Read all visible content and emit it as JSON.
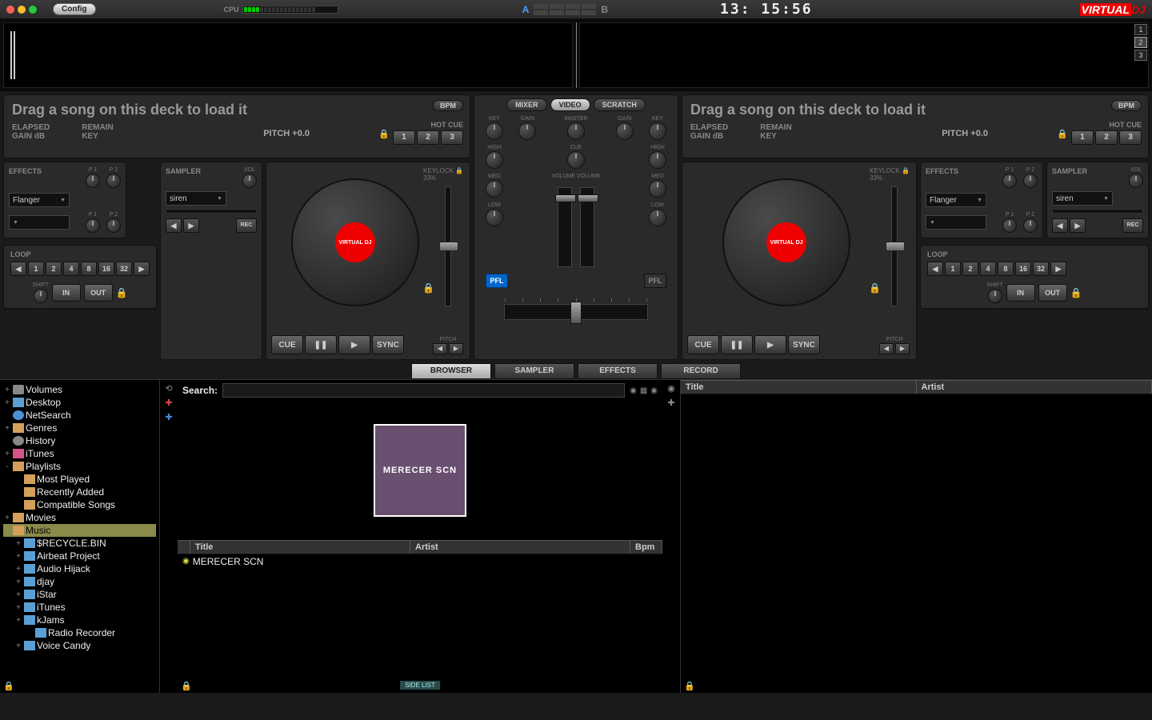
{
  "topbar": {
    "config": "Config",
    "cpu": "CPU",
    "clock": "13: 15:56",
    "logo_v": "VIRTUAL",
    "logo_d": "DJ",
    "deck_a": "A",
    "deck_b": "B"
  },
  "pages": [
    "1",
    "2",
    "3"
  ],
  "deck": {
    "drag": "Drag a song on this deck to load it",
    "elapsed": "ELAPSED",
    "remain": "REMAIN",
    "gain": "GAIN dB",
    "key_lbl": "KEY",
    "pitch": "PITCH +0.0",
    "bpm": "BPM",
    "hotcue": "HOT CUE",
    "cues": [
      "1",
      "2",
      "3"
    ],
    "effects": "EFFECTS",
    "sampler": "SAMPLER",
    "loop": "LOOP",
    "fx_sel": "Flanger",
    "smp_sel": "siren",
    "knobs": {
      "p1": "P 1",
      "p2": "P 2",
      "vol": "VOL",
      "rec": "REC"
    },
    "loops": [
      "1",
      "2",
      "4",
      "8",
      "16",
      "32"
    ],
    "shift": "SHIFT",
    "in": "IN",
    "out": "OUT",
    "keylock": "KEYLOCK",
    "keylock_pct": "33%",
    "pitch_lbl": "PITCH",
    "cue": "CUE",
    "sync": "SYNC",
    "jog": "VIRTUAL DJ"
  },
  "mixer": {
    "tabs": {
      "mixer": "MIXER",
      "video": "VIDEO",
      "scratch": "SCRATCH"
    },
    "knobs": {
      "key": "KEY",
      "gain": "GAIN",
      "master": "MASTER",
      "cue": "CUE",
      "high": "HIGH",
      "med": "MED",
      "low": "LOW",
      "volume": "VOLUME"
    },
    "pfl": "PFL"
  },
  "browser_tabs": {
    "browser": "BROWSER",
    "sampler": "SAMPLER",
    "effects": "EFFECTS",
    "record": "RECORD"
  },
  "tree": [
    {
      "exp": "+",
      "ico": "ico-disk",
      "txt": "Volumes",
      "lvl": 0
    },
    {
      "exp": "+",
      "ico": "ico-folder",
      "txt": "Desktop",
      "lvl": 0
    },
    {
      "exp": "",
      "ico": "ico-globe",
      "txt": "NetSearch",
      "lvl": 0
    },
    {
      "exp": "+",
      "ico": "ico-folder-y",
      "txt": "Genres",
      "lvl": 0
    },
    {
      "exp": "",
      "ico": "ico-clock",
      "txt": "History",
      "lvl": 0
    },
    {
      "exp": "+",
      "ico": "ico-note",
      "txt": "iTunes",
      "lvl": 0
    },
    {
      "exp": "-",
      "ico": "ico-folder-y",
      "txt": "Playlists",
      "lvl": 0
    },
    {
      "exp": "",
      "ico": "ico-folder-y",
      "txt": "Most Played",
      "lvl": 1
    },
    {
      "exp": "",
      "ico": "ico-folder-y",
      "txt": "Recently Added",
      "lvl": 1
    },
    {
      "exp": "",
      "ico": "ico-folder-y",
      "txt": "Compatible Songs",
      "lvl": 1
    },
    {
      "exp": "+",
      "ico": "ico-folder-y",
      "txt": "Movies",
      "lvl": 0
    },
    {
      "exp": "-",
      "ico": "ico-folder-y",
      "txt": "Music",
      "lvl": 0,
      "sel": true
    },
    {
      "exp": "+",
      "ico": "ico-folder",
      "txt": "$RECYCLE.BIN",
      "lvl": 1
    },
    {
      "exp": "+",
      "ico": "ico-folder",
      "txt": "Airbeat Project",
      "lvl": 1
    },
    {
      "exp": "+",
      "ico": "ico-folder",
      "txt": "Audio Hijack",
      "lvl": 1
    },
    {
      "exp": "+",
      "ico": "ico-folder",
      "txt": "djay",
      "lvl": 1
    },
    {
      "exp": "+",
      "ico": "ico-folder",
      "txt": "iStar",
      "lvl": 1
    },
    {
      "exp": "+",
      "ico": "ico-folder",
      "txt": "iTunes",
      "lvl": 1
    },
    {
      "exp": "+",
      "ico": "ico-folder",
      "txt": "kJams",
      "lvl": 1
    },
    {
      "exp": "",
      "ico": "ico-folder",
      "txt": "Radio Recorder",
      "lvl": 2
    },
    {
      "exp": "+",
      "ico": "ico-folder",
      "txt": "Voice Candy",
      "lvl": 1
    }
  ],
  "search": {
    "label": "Search:",
    "placeholder": ""
  },
  "cover": "MERECER SCN",
  "cols": {
    "title": "Title",
    "artist": "Artist",
    "bpm": "Bpm"
  },
  "tracks": [
    {
      "title": "MERECER SCN",
      "artist": "",
      "bpm": ""
    }
  ],
  "right_cols": {
    "title": "Title",
    "artist": "Artist"
  },
  "sidelist": "SIDE LIST"
}
